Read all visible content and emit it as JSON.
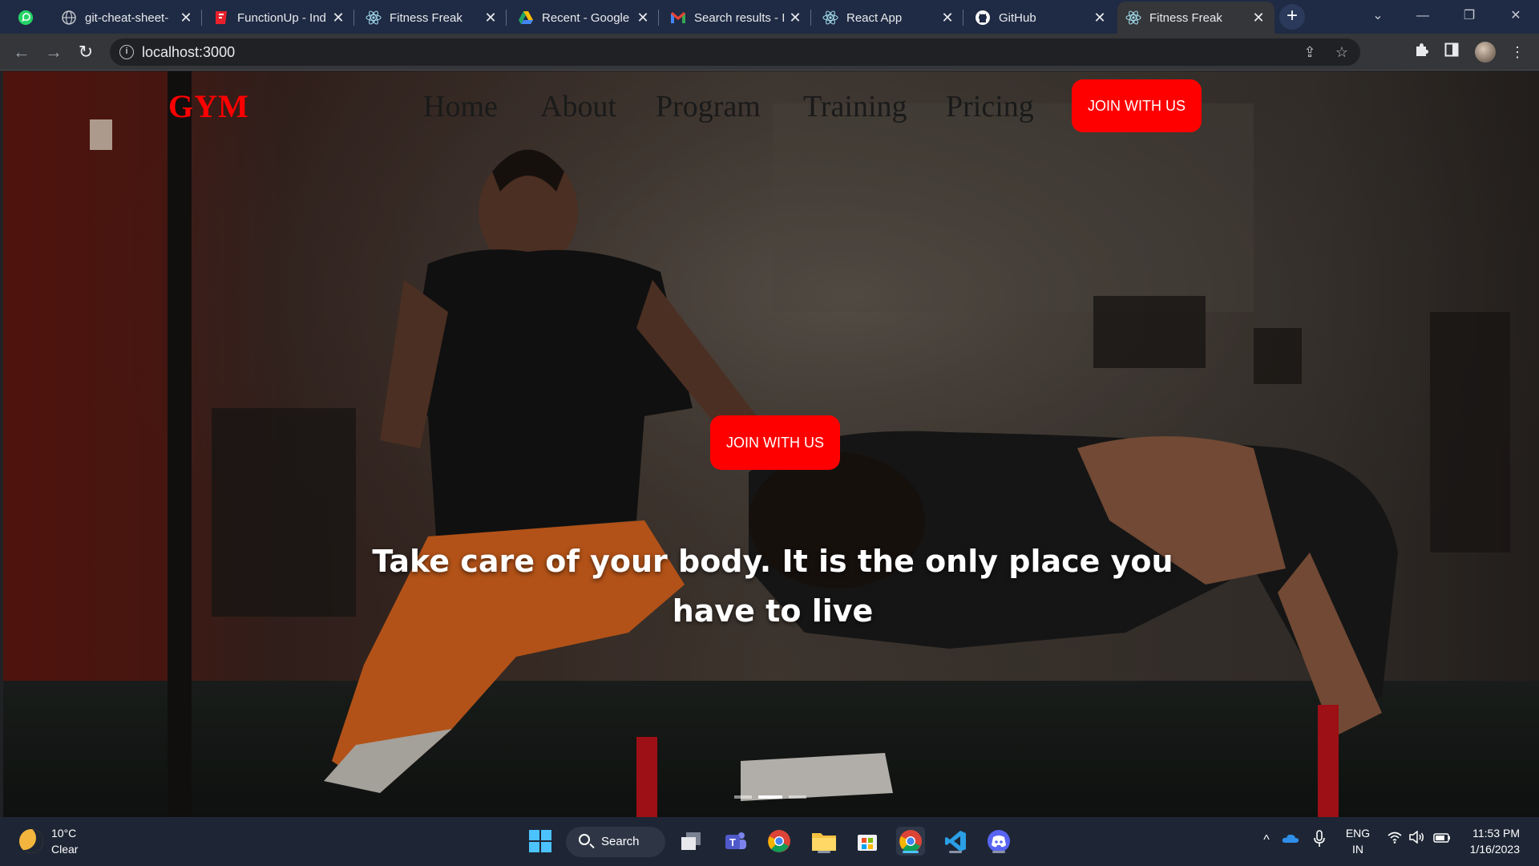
{
  "browser": {
    "tabs": [
      {
        "title": "",
        "icon": "whatsapp-icon"
      },
      {
        "title": "git-cheat-sheet-",
        "icon": "globe-icon"
      },
      {
        "title": "FunctionUp - Ind",
        "icon": "functionup-icon"
      },
      {
        "title": "Fitness Freak",
        "icon": "react-icon"
      },
      {
        "title": "Recent - Google",
        "icon": "google-drive-icon"
      },
      {
        "title": "Search results - I",
        "icon": "gmail-icon"
      },
      {
        "title": "React App",
        "icon": "react-icon"
      },
      {
        "title": "GitHub",
        "icon": "github-icon"
      },
      {
        "title": "Fitness Freak",
        "icon": "react-icon",
        "active": true
      }
    ],
    "close_glyph": "✕",
    "new_tab_glyph": "+",
    "url": "localhost:3000"
  },
  "site": {
    "logo": "GYM",
    "nav": [
      "Home",
      "About",
      "Program",
      "Training",
      "Pricing"
    ],
    "header_cta": "JOIN WITH US",
    "hero_cta": "JOIN WITH US",
    "headline": "Take care of your body. It is the only place you have to live",
    "carousel": {
      "count": 3,
      "active_index": 1
    },
    "colors": {
      "accent": "#ff0000",
      "nav_text": "#1a1a1a",
      "headline": "#ffffff"
    }
  },
  "taskbar": {
    "weather": {
      "temp": "10°C",
      "condition": "Clear"
    },
    "search_label": "Search",
    "language": {
      "line1": "ENG",
      "line2": "IN"
    },
    "clock": {
      "time": "11:53 PM",
      "date": "1/16/2023"
    }
  }
}
